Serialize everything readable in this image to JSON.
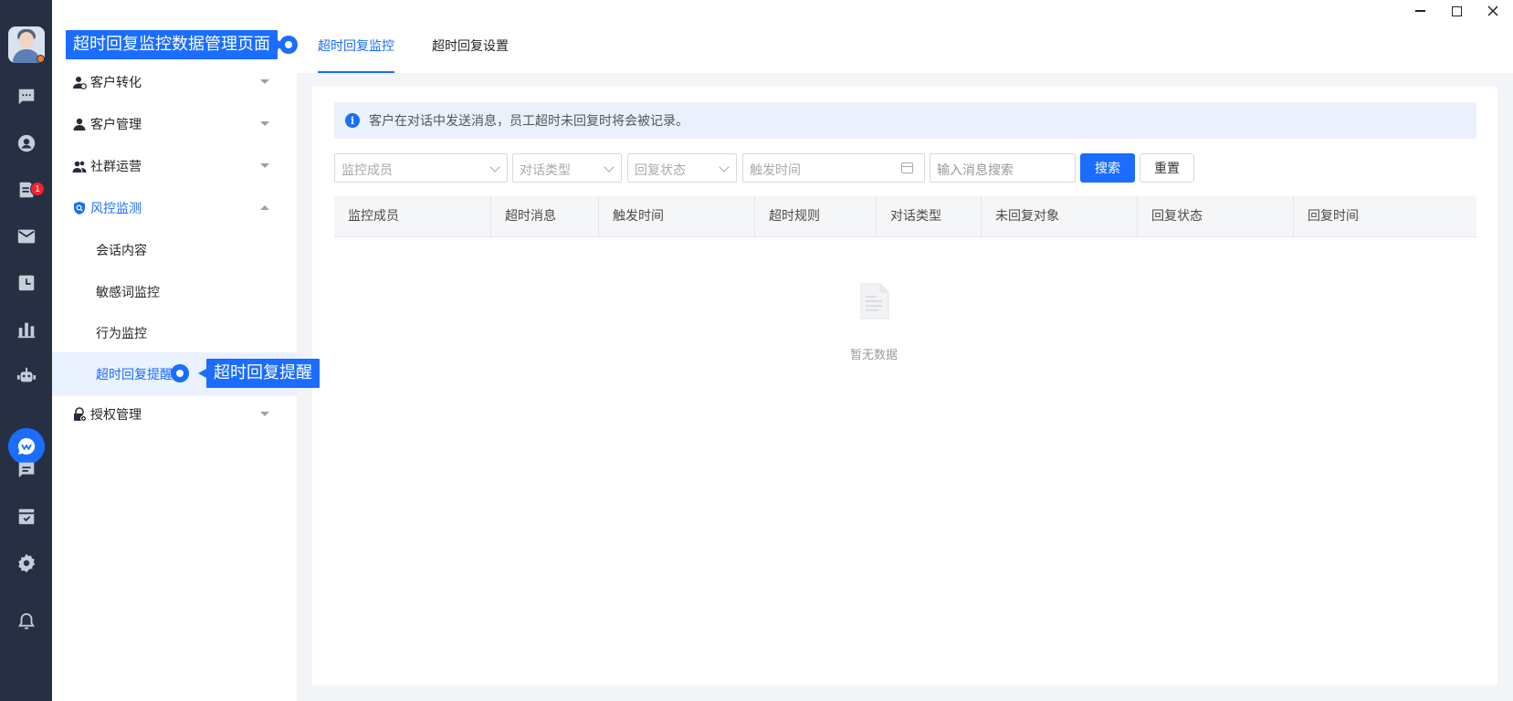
{
  "window": {
    "minimize_icon": "minimize-icon",
    "maximize_icon": "maximize-icon",
    "close_icon": "close-icon"
  },
  "rail": {
    "badge_count": "1",
    "icons": [
      "chat-icon",
      "contact-icon",
      "tasks-icon",
      "mail-icon",
      "calendar-icon",
      "stats-icon",
      "robot-icon",
      "customer-service-icon",
      "message-icon",
      "checklist-icon",
      "settings-icon",
      "bell-icon"
    ],
    "colors": {
      "rail_bg": "#273043",
      "accent": "#1a6dff",
      "badge": "#f5222d"
    }
  },
  "sidebar": {
    "items": [
      {
        "label": "客户转化",
        "icon": "user-convert-icon",
        "expanded": false
      },
      {
        "label": "客户管理",
        "icon": "user-icon",
        "expanded": false
      },
      {
        "label": "社群运营",
        "icon": "group-icon",
        "expanded": false
      },
      {
        "label": "风控监测",
        "icon": "shield-search-icon",
        "expanded": true,
        "children": [
          {
            "label": "会话内容"
          },
          {
            "label": "敏感词监控"
          },
          {
            "label": "行为监控"
          },
          {
            "label": "超时回复提醒",
            "active": true
          }
        ]
      },
      {
        "label": "授权管理",
        "icon": "lock-key-icon",
        "expanded": false
      }
    ]
  },
  "callouts": {
    "page": "超时回复监控数据管理页面",
    "menu": "超时回复提醒"
  },
  "tabs": [
    {
      "label": "超时回复监控",
      "active": true
    },
    {
      "label": "超时回复设置",
      "active": false
    }
  ],
  "notice": {
    "text": "客户在对话中发送消息，员工超时未回复时将会被记录。"
  },
  "filters": {
    "member_placeholder": "监控成员",
    "type_placeholder": "对话类型",
    "status_placeholder": "回复状态",
    "time_placeholder": "触发时间",
    "search_placeholder": "输入消息搜索"
  },
  "buttons": {
    "search": "搜索",
    "reset": "重置"
  },
  "table": {
    "columns": [
      "监控成员",
      "超时消息",
      "触发时间",
      "超时规则",
      "对话类型",
      "未回复对象",
      "回复状态",
      "回复时间"
    ],
    "rows": [],
    "empty_text": "暂无数据"
  }
}
